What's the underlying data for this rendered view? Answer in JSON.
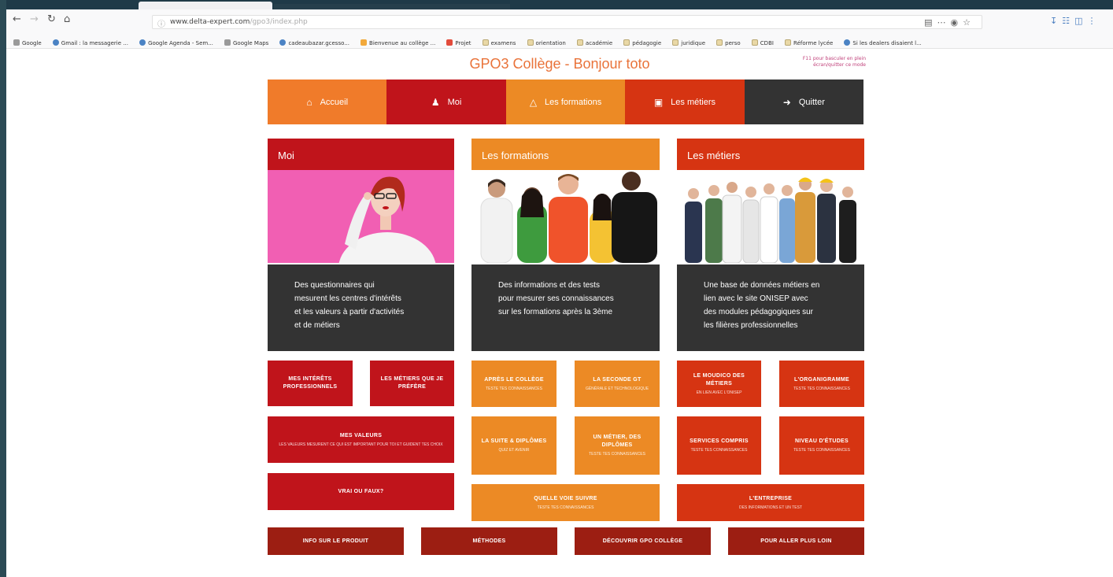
{
  "browser": {
    "url_domain": "www.delta-expert.com",
    "url_path": "/gpo3/index.php",
    "bookmarks": [
      "Google",
      "Gmail : la messagerie ...",
      "Google Agenda - Sem...",
      "Google Maps",
      "cadeaubazar.gcesso...",
      "Bienvenue au collège ...",
      "Projet",
      "examens",
      "orientation",
      "académie",
      "pédagogie",
      "juridique",
      "perso",
      "CDBI",
      "Réforme lycée",
      "Si les dealers disaient l..."
    ]
  },
  "site": {
    "title": "GPO3 Collège - Bonjour toto",
    "corner_note": "F11 pour basculer en plein écran/quitter ce mode"
  },
  "nav": [
    {
      "label": "Accueil",
      "icon": "home-icon",
      "color": "#f07b2a"
    },
    {
      "label": "Moi",
      "icon": "user-icon",
      "color": "#c0141b"
    },
    {
      "label": "Les formations",
      "icon": "graduation-cap-icon",
      "color": "#ec8a25"
    },
    {
      "label": "Les métiers",
      "icon": "briefcase-icon",
      "color": "#d63412"
    },
    {
      "label": "Quitter",
      "icon": "sign-out-icon",
      "color": "#333333"
    }
  ],
  "columns": [
    {
      "title": "Moi",
      "color": "#c0141b",
      "text": [
        "Des questionnaires qui",
        "mesurent les centres d'intérêts",
        "et les valeurs à partir d'activités",
        "et de métiers"
      ]
    },
    {
      "title": "Les formations",
      "color": "#ec8a25",
      "text": [
        "Des informations et des tests",
        "pour mesurer ses connaissances",
        "sur les formations après la 3ème"
      ]
    },
    {
      "title": "Les métiers",
      "color": "#d63412",
      "text": [
        "Une base de données métiers en",
        "lien avec le site ONISEP avec",
        "des modules pédagogiques sur",
        "les filières professionnelles"
      ]
    }
  ],
  "tiles": {
    "moi": [
      {
        "title": "MES INTÉRÊTS PROFESSIONNELS",
        "sub": ""
      },
      {
        "title": "LES MÉTIERS QUE JE PRÉFÈRE",
        "sub": ""
      },
      {
        "title": "MES VALEURS",
        "sub": "LES VALEURS MESURENT CE QUI EST IMPORTANT POUR TOI ET GUIDENT TES CHOIX"
      },
      {
        "title": "VRAI OU FAUX?",
        "sub": ""
      }
    ],
    "formations": [
      {
        "title": "APRÈS LE COLLÈGE",
        "sub": "TESTE TES CONNAISSANCES"
      },
      {
        "title": "LA SECONDE GT",
        "sub": "GÉNÉRALE ET TECHNOLOGIQUE"
      },
      {
        "title": "LA SUITE & DIPLÔMES",
        "sub": "QUIZ ET AVENIR"
      },
      {
        "title": "UN MÉTIER, DES DIPLÔMES",
        "sub": "TESTE TES CONNAISSANCES"
      },
      {
        "title": "QUELLE VOIE SUIVRE",
        "sub": "TESTE TES CONNAISSANCES"
      }
    ],
    "metiers": [
      {
        "title": "LE MOUDICO DES MÉTIERS",
        "sub": "EN LIEN AVEC L'ONISEP"
      },
      {
        "title": "L'ORGANIGRAMME",
        "sub": "TESTE TES CONNAISSANCES"
      },
      {
        "title": "SERVICES COMPRIS",
        "sub": "TESTE TES CONNAISSANCES"
      },
      {
        "title": "NIVEAU D'ÉTUDES",
        "sub": "TESTE TES CONNAISSANCES"
      },
      {
        "title": "L'ENTREPRISE",
        "sub": "DES INFORMATIONS ET UN TEST"
      }
    ],
    "bottom": [
      {
        "title": "INFO SUR LE PRODUIT"
      },
      {
        "title": "MÉTHODES"
      },
      {
        "title": "DÉCOUVRIR GPO COLLÈGE"
      },
      {
        "title": "POUR ALLER PLUS LOIN"
      }
    ]
  }
}
